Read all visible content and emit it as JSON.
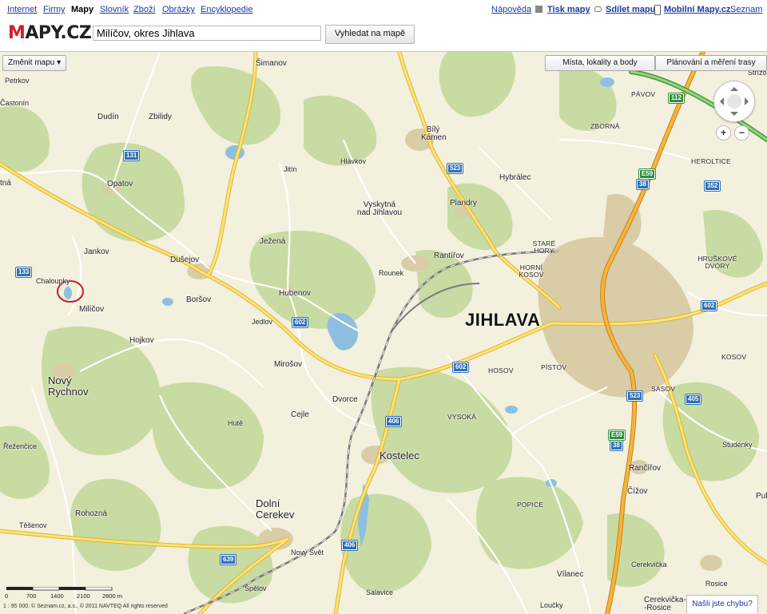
{
  "nav": {
    "left": [
      {
        "label": "Internet",
        "active": false
      },
      {
        "label": "Firmy",
        "active": false
      },
      {
        "label": "Mapy",
        "active": true
      },
      {
        "label": "Slovník",
        "active": false
      },
      {
        "label": "Zboží",
        "active": false
      },
      {
        "label": "Obrázky",
        "active": false
      },
      {
        "label": "Encyklopedie",
        "active": false
      }
    ],
    "right": {
      "help": "Nápověda",
      "print": "Tisk mapy",
      "share": "Sdílet mapu",
      "mobile": "Mobilní Mapy.cz",
      "seznam": "Seznam"
    }
  },
  "logo": {
    "mark": "M",
    "text": "APY.CZ"
  },
  "search": {
    "value": "Milíčov, okres Jihlava",
    "button": "Vyhledat na mapě"
  },
  "controls": {
    "change_map": "Změnit mapu ▾",
    "places": "Místa, lokality a body",
    "planning": "Plánování a měření trasy",
    "zoom_in": "+",
    "zoom_out": "−"
  },
  "map": {
    "places": {
      "simanov": "Šimanov",
      "petrkov": "Petrkov",
      "castonin": "Častonín",
      "dudin": "Dudín",
      "zbilidy": "Zbilidy",
      "opatov": "Opatov",
      "jitin": "Jitín",
      "hlavkov": "Hlávkov",
      "bily": "Bílý\nKámen",
      "hybralec": "Hybrálec",
      "pavov": "PÁVOV",
      "zborna": "ZBORNÁ",
      "heroltice": "HEROLTICE",
      "vyskytna": "Vyskytná\nnad Jihlavou",
      "plandry": "Plandry",
      "jankov": "Jankov",
      "dusejov": "Dušejov",
      "jezena": "Ježená",
      "rantirov": "Rantířov",
      "stare": "STARÉ\nHORY",
      "horni": "HORNÍ\nKOSOV",
      "hruskove": "HRUŠKOVÉ\nDVORY",
      "chaloupky": "Chaloupky",
      "rounek": "Rounek",
      "milicov": "Milíčov",
      "borsov": "Boršov",
      "hubenov": "Hubenov",
      "jedlov": "Jedlov",
      "jihlava": "JIHLAVA",
      "hojkov": "Hojkov",
      "mirosov": "Mirošov",
      "hosov": "HOSOV",
      "pistov": "PÍSTOV",
      "kosov": "KOSOV",
      "novy": "Nový\nRychnov",
      "dvorce": "Dvorce",
      "sasov": "SASOV",
      "cejle": "Cejle",
      "hute": "Hutě",
      "vysoka": "VYSOKÁ",
      "rezencice": "Řeženčice",
      "studenky": "Studénky",
      "kostelec": "Kostelec",
      "rancirov": " Rančířov",
      "popice": "POPICE",
      "cizov": "Čížov",
      "rohozna": "Rohozná",
      "dolni": "Dolní\nCerekev",
      "tesenov": "Těšenov",
      "novysvet": "Nový Svět",
      "vilanec": "Vílanec",
      "cerekvicka": "Cerekvička",
      "spelov": "Špělov",
      "salavice": "Salavice",
      "rosice": "Rosice",
      "cerekvicka2": "Cerekvička-\n-Rosice",
      "loucky": "Loučky",
      "strizd": "Střížo",
      "puk": "Puk",
      "jihlava_w": "Jihlava",
      "ptna": "tná"
    },
    "roads": [
      "131",
      "523",
      "602",
      "602",
      "602",
      "602",
      "406",
      "406",
      "38",
      "38",
      "352",
      "523",
      "405",
      "639",
      "133",
      "112",
      "E59",
      "E59"
    ],
    "scale": {
      "ticks": [
        "0",
        "700",
        "1400",
        "2100",
        "2800 m"
      ]
    },
    "copyright": "1 : 95 000, © Seznam.cz, a.s., © 2011 NAVTEQ All rights reserved",
    "report": "Našli jste chybu?"
  },
  "colors": {
    "road_major": "#f7d64a",
    "road_primary": "#fbe68a",
    "motorway": "#e8a31a",
    "forest": "#c8dba2",
    "land": "#f3f0de",
    "urban": "#d9cda7",
    "water": "#8fbfe0",
    "rail": "#777777",
    "link": "#1a3aa6"
  }
}
